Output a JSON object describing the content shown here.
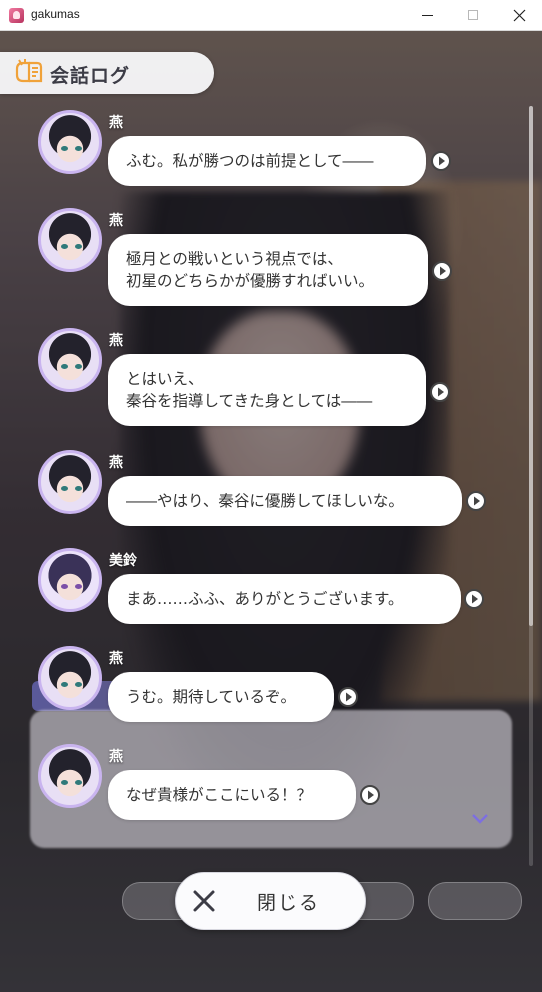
{
  "window": {
    "title": "gakumas"
  },
  "log": {
    "title": "会話ログ",
    "close_label": "閉じる",
    "entries": [
      {
        "speaker": "燕",
        "text": "ふむ。私が勝つのは前提として――"
      },
      {
        "speaker": "燕",
        "text": "極月との戦いという視点では、\n初星のどちらかが優勝すればいい。"
      },
      {
        "speaker": "燕",
        "text": "とはいえ、\n秦谷を指導してきた身としては――"
      },
      {
        "speaker": "燕",
        "text": "――やはり、秦谷に優勝してほしいな。"
      },
      {
        "speaker": "美鈴",
        "text": "まあ……ふふ、ありがとうございます。"
      },
      {
        "speaker": "燕",
        "text": "うむ。期待しているぞ。"
      },
      {
        "speaker": "燕",
        "text": "なぜ貴様がここにいる！？"
      }
    ]
  },
  "colors": {
    "accent": "#c9b4ef",
    "bubble": "#ffffff"
  },
  "icons": [
    "app-icon",
    "minimize-icon",
    "maximize-icon",
    "close-window-icon",
    "log-book-icon",
    "avatar-icon",
    "play-voice-icon",
    "close-x-icon"
  ]
}
